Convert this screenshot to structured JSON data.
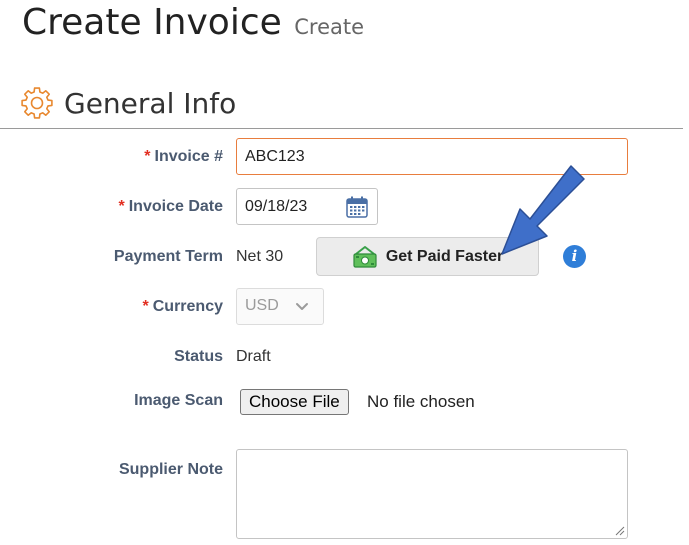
{
  "page": {
    "title": "Create Invoice",
    "subtitle": "Create"
  },
  "section": {
    "title": "General Info",
    "icon": "gear-icon"
  },
  "fields": {
    "invoice_number": {
      "label": "Invoice #",
      "required_mark": "*",
      "value": "ABC123"
    },
    "invoice_date": {
      "label": "Invoice Date",
      "required_mark": "*",
      "value": "09/18/23",
      "icon": "calendar-icon"
    },
    "payment_term": {
      "label": "Payment Term",
      "value": "Net 30",
      "button_label": "Get Paid Faster",
      "button_icon": "money-icon",
      "info_icon": "info-icon"
    },
    "currency": {
      "label": "Currency",
      "required_mark": "*",
      "value": "USD"
    },
    "status": {
      "label": "Status",
      "value": "Draft"
    },
    "image_scan": {
      "label": "Image Scan",
      "button_label": "Choose File",
      "file_status": "No file chosen"
    },
    "supplier_note": {
      "label": "Supplier Note",
      "value": ""
    }
  },
  "annotation": {
    "arrow_color": "#3f6fc9",
    "points_to": "Get Paid Faster"
  },
  "colors": {
    "accent_orange": "#e87d3e",
    "required_red": "#e22f22",
    "label_blue_gray": "#4b5a70",
    "info_blue": "#2f7ed8"
  }
}
